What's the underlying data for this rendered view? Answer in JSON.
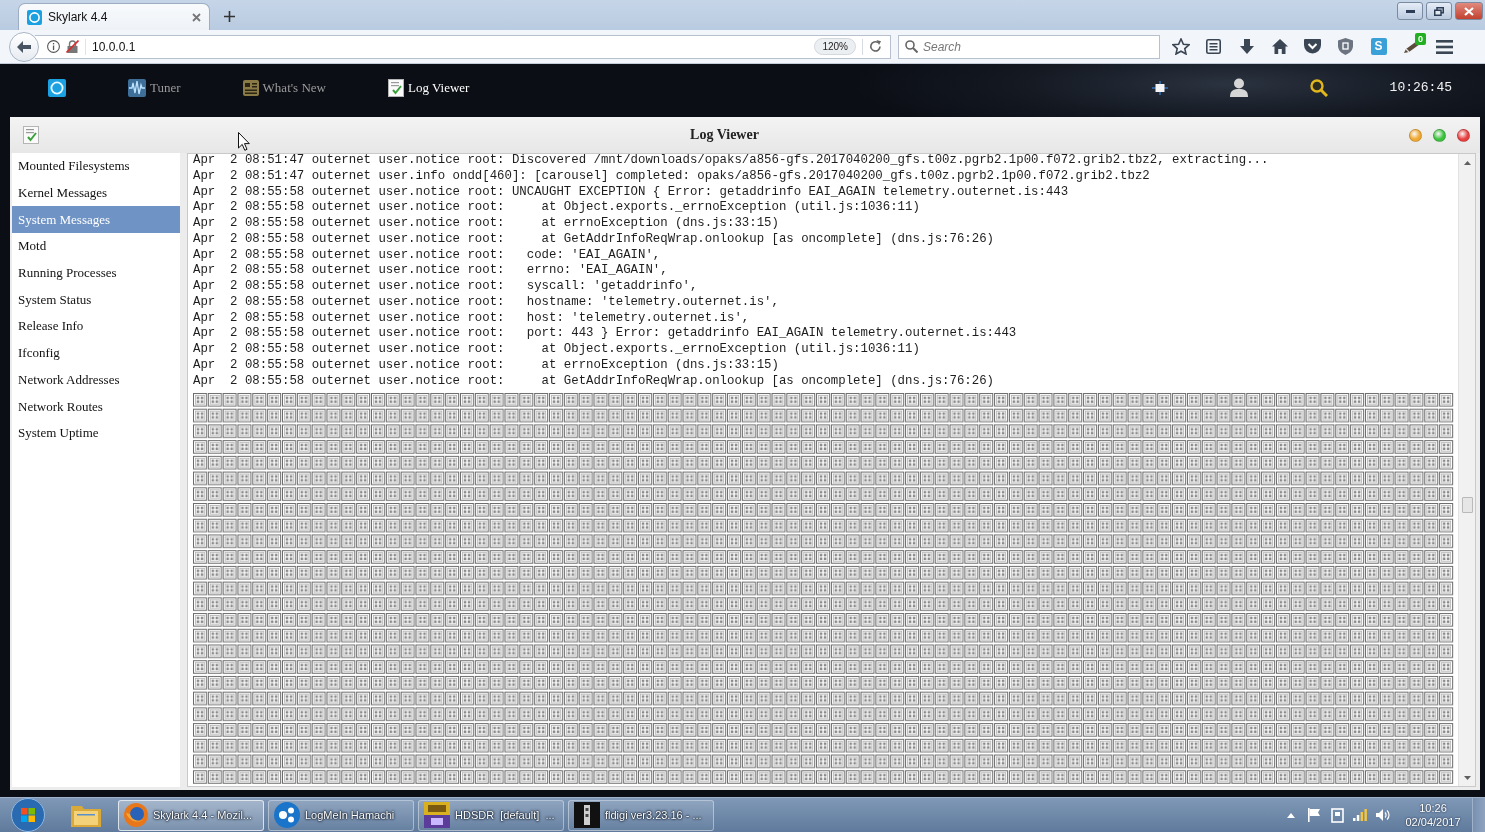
{
  "browser": {
    "tabs": [
      {
        "title": "Skylark 4.4",
        "selected": true
      }
    ],
    "address": "10.0.0.1",
    "zoom": "120%",
    "search": {
      "placeholder": "Search"
    },
    "tile_letter": "S",
    "extension_badge": "0"
  },
  "app_nav": {
    "items": [
      {
        "kind": "tuner",
        "label": "Tuner",
        "selected": false
      },
      {
        "kind": "news",
        "label": "What's New",
        "selected": false
      },
      {
        "kind": "log",
        "label": "Log Viewer",
        "selected": true
      }
    ],
    "clock": "10:26:45"
  },
  "window": {
    "title": "Log Viewer"
  },
  "sidebar": {
    "items": [
      {
        "label": "Mounted Filesystems",
        "selected": false
      },
      {
        "label": "Kernel Messages",
        "selected": false
      },
      {
        "label": "System Messages",
        "selected": true
      },
      {
        "label": "Motd",
        "selected": false
      },
      {
        "label": "Running Processes",
        "selected": false
      },
      {
        "label": "System Status",
        "selected": false
      },
      {
        "label": "Release Info",
        "selected": false
      },
      {
        "label": "Ifconfig",
        "selected": false
      },
      {
        "label": "Network Addresses",
        "selected": false
      },
      {
        "label": "Network Routes",
        "selected": false
      },
      {
        "label": "System Uptime",
        "selected": false
      }
    ]
  },
  "log": {
    "lines": [
      "Apr  2 08:51:47 outernet user.notice root: Discovered /mnt/downloads/opaks/a856-gfs.2017040200_gfs.t00z.pgrb2.1p00.f072.grib2.tbz2, extracting...",
      "Apr  2 08:51:47 outernet user.info ondd[460]: [carousel] completed: opaks/a856-gfs.2017040200_gfs.t00z.pgrb2.1p00.f072.grib2.tbz2",
      "Apr  2 08:55:58 outernet user.notice root: UNCAUGHT EXCEPTION { Error: getaddrinfo EAI_AGAIN telemetry.outernet.is:443",
      "Apr  2 08:55:58 outernet user.notice root:     at Object.exports._errnoException (util.js:1036:11)",
      "Apr  2 08:55:58 outernet user.notice root:     at errnoException (dns.js:33:15)",
      "Apr  2 08:55:58 outernet user.notice root:     at GetAddrInfoReqWrap.onlookup [as oncomplete] (dns.js:76:26)",
      "Apr  2 08:55:58 outernet user.notice root:   code: 'EAI_AGAIN',",
      "Apr  2 08:55:58 outernet user.notice root:   errno: 'EAI_AGAIN',",
      "Apr  2 08:55:58 outernet user.notice root:   syscall: 'getaddrinfo',",
      "Apr  2 08:55:58 outernet user.notice root:   hostname: 'telemetry.outernet.is',",
      "Apr  2 08:55:58 outernet user.notice root:   host: 'telemetry.outernet.is',",
      "Apr  2 08:55:58 outernet user.notice root:   port: 443 } Error: getaddrinfo EAI_AGAIN telemetry.outernet.is:443",
      "Apr  2 08:55:58 outernet user.notice root:     at Object.exports._errnoException (util.js:1036:11)",
      "Apr  2 08:55:58 outernet user.notice root:     at errnoException (dns.js:33:15)",
      "Apr  2 08:55:58 outernet user.notice root:     at GetAddrInfoReqWrap.onlookup [as oncomplete] (dns.js:76:26)"
    ]
  },
  "taskbar": {
    "tasks": [
      {
        "kind": "browser",
        "label": "Skylark 4.4 - Mozil...",
        "selected": true
      },
      {
        "kind": "hamachi",
        "label": "LogMeIn Hamachi",
        "selected": false
      },
      {
        "kind": "hdsdr",
        "label": "HDSDR  [default]  ...",
        "selected": false
      },
      {
        "kind": "fldigi",
        "label": "fldigi ver3.23.16 - ...",
        "selected": false
      }
    ],
    "time": "10:26",
    "date": "02/04/2017"
  }
}
